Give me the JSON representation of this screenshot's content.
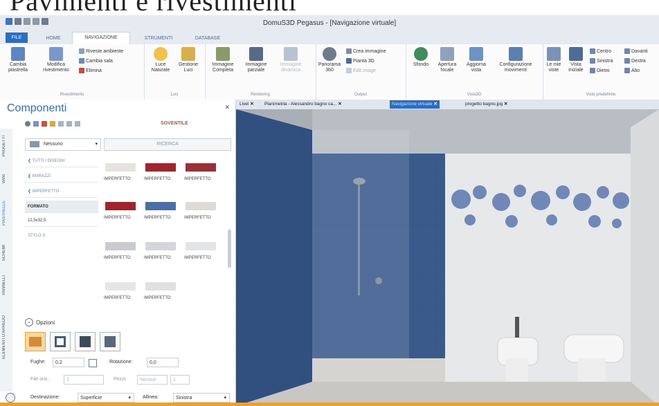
{
  "banner": {
    "text": "Pavimenti e rivestimenti"
  },
  "window": {
    "title": "DomuS3D Pegasus - [Navigazione virtuale]"
  },
  "tabs": [
    {
      "label": "FILE"
    },
    {
      "label": "HOME"
    },
    {
      "label": "NAVIGAZIONE"
    },
    {
      "label": "STRUMENTI"
    },
    {
      "label": "DATABASE"
    }
  ],
  "ribbon": {
    "groups": {
      "rivestimento": "Rivestimento",
      "luci": "Luci",
      "rendering": "Rendering",
      "output": "Output",
      "vista3d": "Vista3D",
      "viste": "Viste predefinite"
    },
    "cambia_piastrella": "Cambia piastrella",
    "modifica_rivestimento": "Modifica rivestimento",
    "riveste_ambiente": "Riveste ambiente",
    "cambia_sala": "Cambia sala",
    "elimina": "Elimina",
    "luce_naturale": "Luce Naturale",
    "gestione_luci": "Gestione Luci",
    "immagine_completa": "Immagine Completa",
    "immagine_parziale": "Immagine parziale",
    "immagine_dinamica": "Immagine dinamica",
    "panorama": "Panorama 360",
    "crea_immagine": "Crea immagine",
    "pianta_3d": "Pianta 3D",
    "edit_image": "Edit image",
    "sfondo": "Sfondo",
    "apertura_focale": "Apertura focale",
    "aggiorna_vista": "Aggiorna vista",
    "configurazione_movimenti": "Configurazione movimenti",
    "le_mie_viste": "Le mie viste",
    "vista_iniziale": "Vista iniziale",
    "centro": "Centro",
    "davanti": "Davanti",
    "sinistra": "Sinistra",
    "destra": "Destra",
    "dietro": "Dietro",
    "alto": "Alto"
  },
  "panel": {
    "title": "Componenti",
    "vtabs": [
      "PROGETTI",
      "VANI",
      "PIASTRELLE",
      "SCHEMI",
      "PANNELLI",
      "ELEMENTI D'ARREDO"
    ],
    "brand": "SOVENTILE",
    "filter_value": "Nessuno",
    "search_label": "RICERCA",
    "categories": [
      "TUTTI I DISEGNI",
      "MARAZZI",
      "IMPERFETTO",
      "FORMATO",
      "12,5x32,5",
      "STYLO S"
    ],
    "tile_label": "IMPERFETTO",
    "options_label": "Opzioni",
    "fughe_label": "Fughe:",
    "fughe_value": "0,2",
    "rotazione_label": "Rotazione:",
    "rotazione_value": "0,0",
    "file_orizz_label": "File oriz:",
    "file_orizz_value": "1",
    "pezzi_label": "Pezzi:",
    "pezzi_value": "Nessun",
    "pezzi_num": "1",
    "destinazione_label": "Destinazione:",
    "destinazione_value": "Superficie",
    "allinea_label": "Allinea:",
    "allinea_value": "Sinistra"
  },
  "doc_tabs": [
    {
      "label": "Livei"
    },
    {
      "label": "Planimetria - Alessandro bagno ca..."
    },
    {
      "label": "Navigazione virtuale"
    },
    {
      "label": "progetto bagno.jpg"
    }
  ],
  "colors": {
    "accent": "#2b6cc4",
    "wall_blue": "#3a5a8c",
    "tile_red": "#a3232b",
    "tile_blue": "#4a6ea8",
    "highlight": "#fbd99d",
    "bottom_bar": "#e8a03b"
  }
}
